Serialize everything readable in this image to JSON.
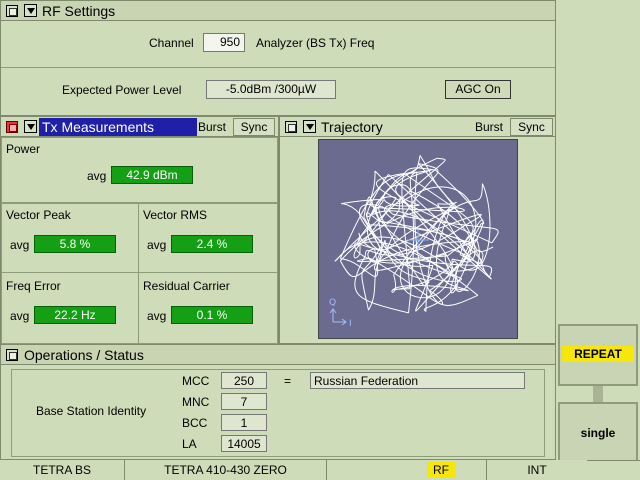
{
  "rf_settings": {
    "title": "RF Settings",
    "channel_label": "Channel",
    "channel_value": "950",
    "freq_label": "Analyzer (BS Tx) Freq",
    "power_label": "Expected Power Level",
    "power_value": "-5.0dBm /300µW",
    "agc_label": "AGC On"
  },
  "tx": {
    "title": "Tx Measurements",
    "burst_label": "Burst",
    "sync_label": "Sync",
    "power_label": "Power",
    "power_avg_label": "avg",
    "power_value": "42.9 dBm",
    "vector_peak_label": "Vector Peak",
    "vector_peak_avg_label": "avg",
    "vector_peak_value": "5.8 %",
    "vector_rms_label": "Vector RMS",
    "vector_rms_avg_label": "avg",
    "vector_rms_value": "2.4 %",
    "freq_error_label": "Freq Error",
    "freq_error_avg_label": "avg",
    "freq_error_value": "22.2 Hz",
    "residual_label": "Residual Carrier",
    "residual_avg_label": "avg",
    "residual_value": "0.1 %"
  },
  "trajectory": {
    "title": "Trajectory",
    "burst_label": "Burst",
    "sync_label": "Sync",
    "axis_q": "Q",
    "axis_i": "I"
  },
  "ops": {
    "title": "Operations / Status",
    "bsi_label": "Base Station Identity",
    "mcc_label": "MCC",
    "mcc_value": "250",
    "equals": "=",
    "country": "Russian Federation",
    "mnc_label": "MNC",
    "mnc_value": "7",
    "bcc_label": "BCC",
    "bcc_value": "1",
    "la_label": "LA",
    "la_value": "14005"
  },
  "side": {
    "repeat_label": "REPEAT",
    "single_label": "single"
  },
  "status": {
    "system": "TETRA BS",
    "band": "TETRA 410-430 ZERO",
    "rf": "RF",
    "int": "INT"
  },
  "colors": {
    "background": "#cfdcba",
    "green_value": "#14a014",
    "trajectory_bg": "#6b6b8f",
    "tx_title_bar": "#1f1fa8",
    "repeat_highlight": "#f6e60a"
  }
}
